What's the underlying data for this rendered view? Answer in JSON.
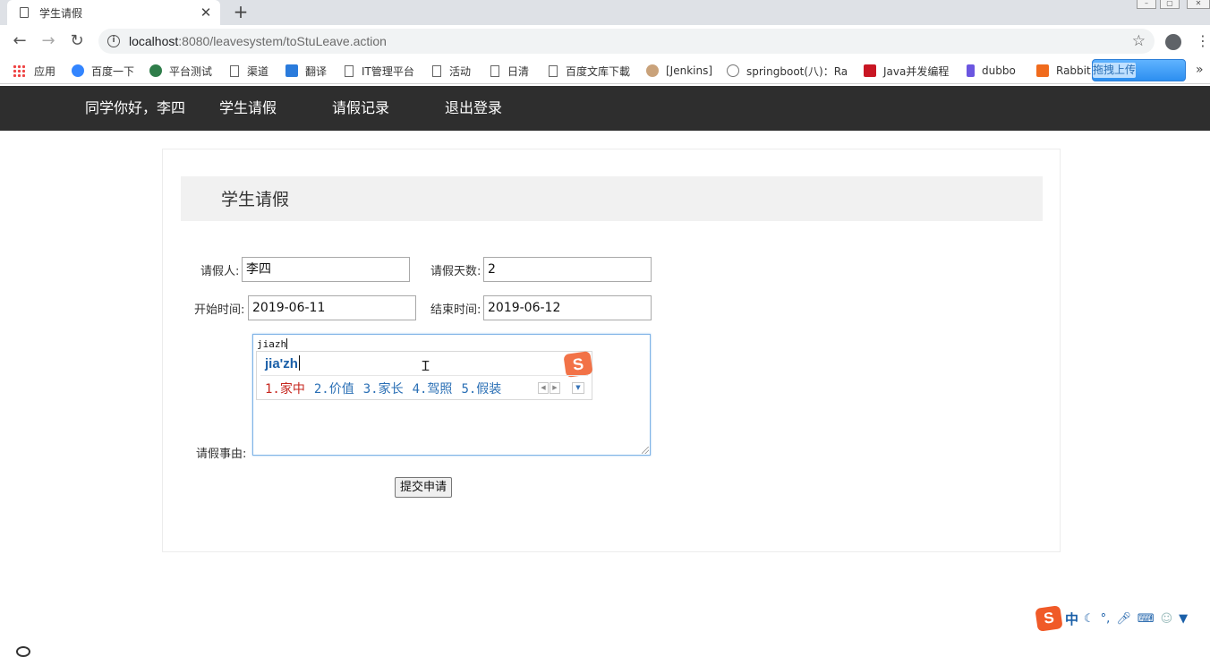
{
  "browser": {
    "tab_title": "学生请假",
    "tab_close": "✕",
    "new_tab": "+",
    "url_host": "localhost",
    "url_rest": ":8080/leavesystem/toStuLeave.action",
    "bookmarks": [
      "应用",
      "百度一下",
      "平台测试",
      "渠道",
      "翻译",
      "IT管理平台",
      "活动",
      "日清",
      "百度文库下載",
      "[Jenkins]",
      "springboot(八)：Ra",
      "Java并发编程",
      "dubbo",
      "Rabbit"
    ],
    "upload_label": "拖拽上传"
  },
  "nav": {
    "greeting": "同学你好，李四",
    "items": [
      "学生请假",
      "请假记录",
      "退出登录"
    ]
  },
  "form": {
    "title": "学生请假",
    "applicant_label": "请假人:",
    "applicant_value": "李四",
    "days_label": "请假天数:",
    "days_value": "2",
    "start_label": "开始时间:",
    "start_value": "2019-06-11",
    "end_label": "结束时间:",
    "end_value": "2019-06-12",
    "reason_label": "请假事由:",
    "reason_value": "jiazh",
    "submit_label": "提交申请"
  },
  "ime": {
    "pinyin": "jia'zh",
    "candidates": [
      "1.家中",
      "2.价值",
      "3.家长",
      "4.驾照",
      "5.假装"
    ],
    "logo": "S",
    "status_mode": "中"
  },
  "colors": {
    "nav_bg": "#2e2e2e",
    "ime_selected": "#c6261e",
    "ime_candidate": "#2a6fb5",
    "sogou_orange": "#f05a28"
  }
}
